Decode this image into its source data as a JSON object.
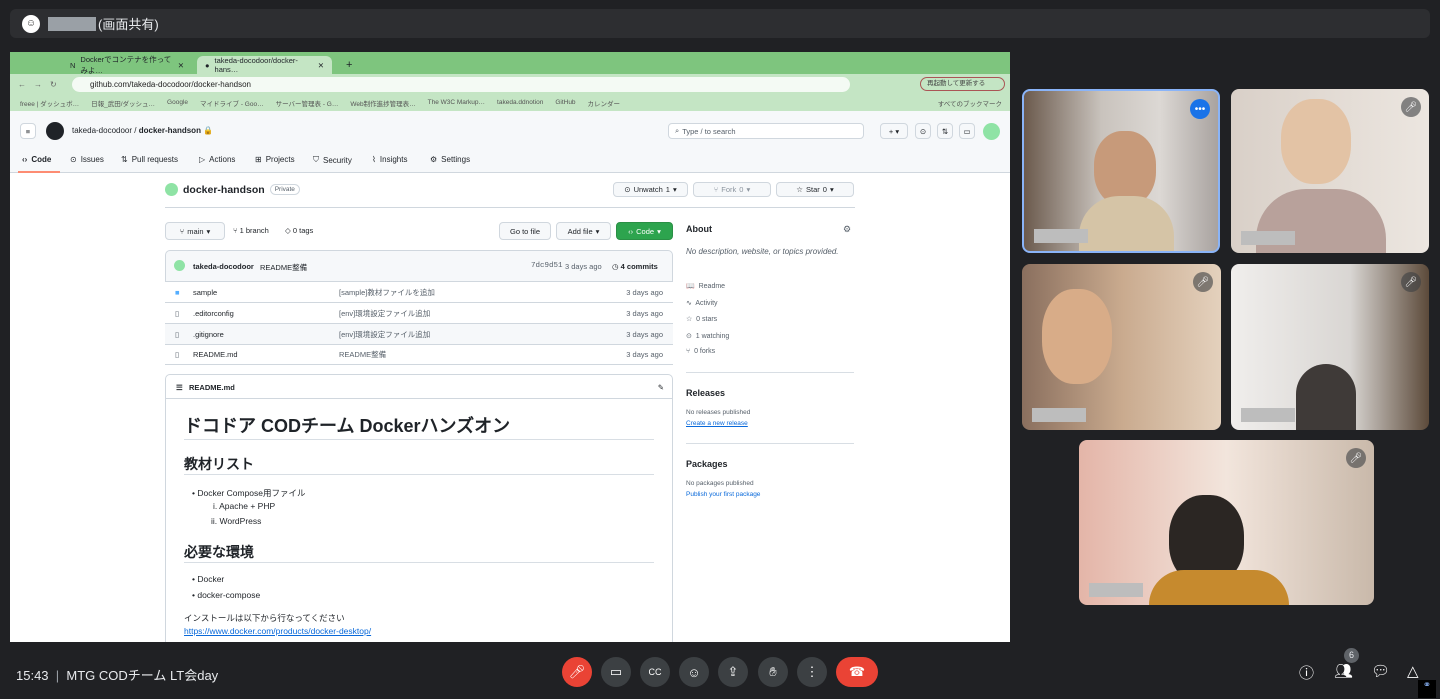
{
  "meet": {
    "presenter_suffix": "(画面共有)",
    "time": "15:43",
    "separator": "|",
    "meeting_title": "MTG CODチーム LT会day",
    "participant_count": "6"
  },
  "browser": {
    "tabs": [
      "Dockerでコンテナを作ってみよ…",
      "takeda-docodoor/docker-hans…"
    ],
    "url": "github.com/takeda-docodoor/docker-handson",
    "update_button": "再起動して更新する",
    "bookmarks": [
      "freee | ダッシュボ…",
      "日報_武田/ダッシュ…",
      "Google",
      "マイドライブ - Goo…",
      "サーバー管理表 - G…",
      "Web制作進捗管理表…",
      "The W3C Markup…",
      "takeda.ddnotion",
      "GitHub",
      "カレンダー"
    ],
    "all_bookmarks": "すべてのブックマーク"
  },
  "github": {
    "owner": "takeda-docodoor",
    "repo": "docker-handson",
    "search_placeholder": "Type / to search",
    "nav": [
      "Code",
      "Issues",
      "Pull requests",
      "Actions",
      "Projects",
      "Security",
      "Insights",
      "Settings"
    ],
    "visibility": "Private",
    "unwatch": "Unwatch",
    "watch_count": "1",
    "fork": "Fork",
    "fork_count": "0",
    "star": "Star",
    "star_count": "0",
    "branch": "main",
    "branches": "1 branch",
    "tags": "0 tags",
    "go_to_file": "Go to file",
    "add_file": "Add file",
    "code_button": "Code",
    "commit": {
      "author": "takeda-docodoor",
      "message": "README整備",
      "hash": "7dc9d51",
      "time": "3 days ago",
      "commits": "4 commits"
    },
    "files": [
      {
        "name": "sample",
        "message": "[sample]教材ファイルを追加",
        "time": "3 days ago"
      },
      {
        "name": ".editorconfig",
        "message": "[env]環境設定ファイル追加",
        "time": "3 days ago"
      },
      {
        "name": ".gitignore",
        "message": "[env]環境設定ファイル追加",
        "time": "3 days ago"
      },
      {
        "name": "README.md",
        "message": "README整備",
        "time": "3 days ago"
      }
    ],
    "about": {
      "title": "About",
      "description": "No description, website, or topics provided.",
      "items": [
        "Readme",
        "Activity",
        "0 stars",
        "1 watching",
        "0 forks"
      ]
    },
    "releases": {
      "title": "Releases",
      "text": "No releases published",
      "link": "Create a new release"
    },
    "packages": {
      "title": "Packages",
      "text": "No packages published",
      "link": "Publish your first package"
    },
    "readme": {
      "filename": "README.md",
      "h1": "ドコドア CODチーム Dockerハンズオン",
      "h2_1": "教材リスト",
      "list1": "Docker Compose用ファイル",
      "sub1": "i. Apache + PHP",
      "sub2": "ii. WordPress",
      "h2_2": "必要な環境",
      "env1": "Docker",
      "env2": "docker-compose",
      "install": "インストールは以下から行なってください",
      "link": "https://www.docker.com/products/docker-desktop/"
    }
  }
}
